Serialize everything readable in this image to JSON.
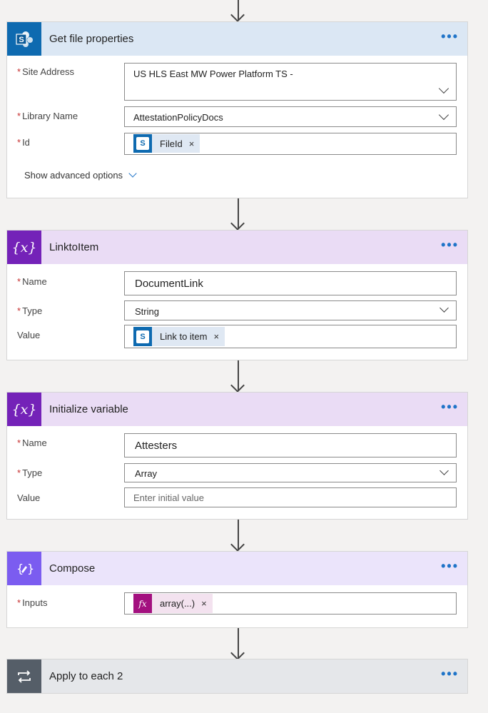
{
  "colors": {
    "sharepoint_blue": "#0e6ab0",
    "sharepoint_header": "#dbe7f4",
    "variable_purple": "#7422b8",
    "variable_header": "#eadcf5",
    "compose_purple": "#7b5cf0",
    "compose_header": "#ebe4fb",
    "apply_gray": "#555e68",
    "apply_header": "#e5e7ea",
    "required_red": "#c63030",
    "link_blue": "#1f74c8"
  },
  "get_file_properties": {
    "title": "Get file properties",
    "icon": "sharepoint-icon",
    "more_label": "•••",
    "site_address": {
      "label": "Site Address",
      "required_mark": "*",
      "value": "US HLS East MW Power Platform TS -"
    },
    "library_name": {
      "label": "Library Name",
      "required_mark": "*",
      "value": "AttestationPolicyDocs"
    },
    "id": {
      "label": "Id",
      "required_mark": "*",
      "token": "FileId",
      "token_remove": "×"
    },
    "advanced_options": "Show advanced options"
  },
  "link_to_item": {
    "title": "LinktoItem",
    "icon": "variable-icon",
    "icon_text": "{x}",
    "more_label": "•••",
    "name": {
      "label": "Name",
      "required_mark": "*",
      "value": "DocumentLink"
    },
    "type": {
      "label": "Type",
      "required_mark": "*",
      "value": "String"
    },
    "value": {
      "label": "Value",
      "token": "Link to item",
      "token_remove": "×"
    }
  },
  "initialize_variable": {
    "title": "Initialize variable",
    "icon": "variable-icon",
    "icon_text": "{x}",
    "more_label": "•••",
    "name": {
      "label": "Name",
      "required_mark": "*",
      "value": "Attesters"
    },
    "type": {
      "label": "Type",
      "required_mark": "*",
      "value": "Array"
    },
    "value": {
      "label": "Value",
      "placeholder": "Enter initial value"
    }
  },
  "compose": {
    "title": "Compose",
    "icon": "compose-icon",
    "more_label": "•••",
    "inputs": {
      "label": "Inputs",
      "required_mark": "*",
      "token": "array(...)",
      "token_icon": "fx",
      "token_remove": "×"
    }
  },
  "apply_to_each": {
    "title": "Apply to each 2",
    "icon": "loop-icon",
    "more_label": "•••"
  }
}
